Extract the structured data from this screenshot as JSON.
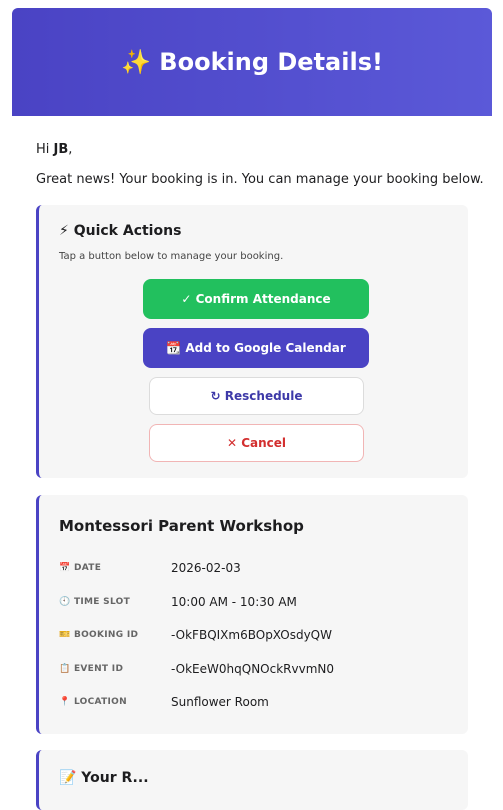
{
  "header": {
    "title": "✨ Booking Details!"
  },
  "greeting": {
    "prefix": "Hi ",
    "name": "JB",
    "suffix": ","
  },
  "intro": "Great news! Your booking is in. You can manage your booking below.",
  "quick_actions": {
    "title": "⚡ Quick Actions",
    "hint": "Tap a button below to manage your booking.",
    "buttons": {
      "confirm": "✓ Confirm Attendance",
      "google_calendar": "📆 Add to Google Calendar",
      "reschedule": "↻ Reschedule",
      "cancel": "✕ Cancel"
    }
  },
  "details": {
    "event_title": "Montessori Parent Workshop",
    "rows": [
      {
        "label": "📅 DATE",
        "value": "2026-02-03"
      },
      {
        "label": "🕙 TIME SLOT",
        "value": "10:00 AM - 10:30 AM"
      },
      {
        "label": "🎫 BOOKING ID",
        "value": "-OkFBQIXm6BOpXOsdyQW"
      },
      {
        "label": "📋 EVENT ID",
        "value": "-OkEeW0hqQNOckRvvmN0"
      },
      {
        "label": "📍 LOCATION",
        "value": "Sunflower Room"
      }
    ]
  },
  "reminder": {
    "title": "📝 Your R..."
  }
}
